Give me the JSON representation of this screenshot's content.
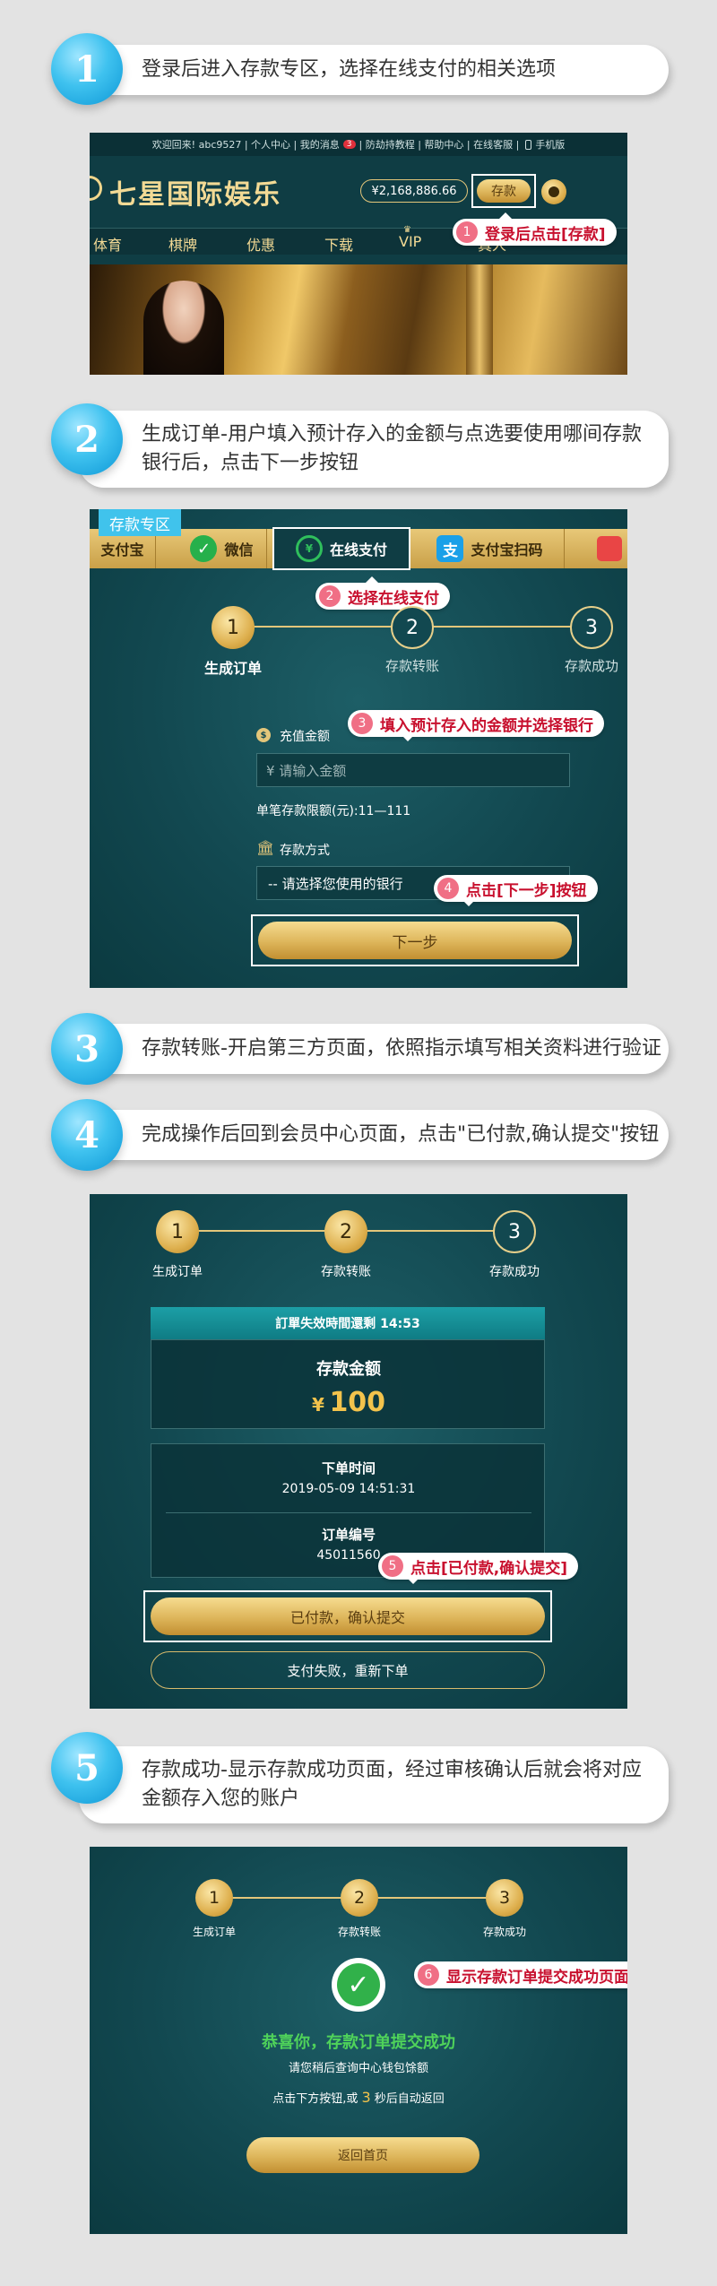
{
  "steps": [
    {
      "number": "1",
      "text": "登录后进入存款专区，选择在线支付的相关选项"
    },
    {
      "number": "2",
      "text": "生成订单-用户填入预计存入的金额与点选要使用哪间存款银行后，点击下一步按钮"
    },
    {
      "number": "3",
      "text": "存款转账-开启第三方页面，依照指示填写相关资料进行验证"
    },
    {
      "number": "4",
      "text": "完成操作后回到会员中心页面，点击\"已付款,确认提交\"按钮"
    },
    {
      "number": "5",
      "text": "存款成功-显示存款成功页面，经过审核确认后就会将对应金额存入您的账户"
    }
  ],
  "panel1": {
    "topbar": "欢迎回来! abc9527 | 个人中心 | 我的消息",
    "msg_badge": "3",
    "topbar_rest": "| 防劫持教程 | 帮助中心 | 在线客服 |",
    "mobile": "手机版",
    "logo": "七星国际娱乐",
    "balance": "¥2,168,886.66",
    "deposit_btn": "存款",
    "nav": [
      "体育",
      "棋牌",
      "优惠",
      "下载",
      "VIP",
      "真人"
    ],
    "callout_num": "1",
    "callout": "登录后点击[存款]"
  },
  "panel2": {
    "tag": "存款专区",
    "tabs": [
      "支付宝",
      "微信",
      "在线支付",
      "支付宝扫码"
    ],
    "callout2_num": "2",
    "callout2": "选择在线支付",
    "progress": [
      {
        "n": "1",
        "label": "生成订单"
      },
      {
        "n": "2",
        "label": "存款转账"
      },
      {
        "n": "3",
        "label": "存款成功"
      }
    ],
    "callout3_num": "3",
    "callout3": "填入预计存入的金额并选择银行",
    "amount_label": "充值金额",
    "amount_placeholder": "¥ 请输入金额",
    "limit": "单笔存款限额(元):11—111",
    "method_label": "存款方式",
    "bank_select": "-- 请选择您使用的银行",
    "callout4_num": "4",
    "callout4": "点击[下一步]按钮",
    "next_btn": "下一步"
  },
  "panel3": {
    "progress": [
      {
        "n": "1",
        "label": "生成订单"
      },
      {
        "n": "2",
        "label": "存款转账"
      },
      {
        "n": "3",
        "label": "存款成功"
      }
    ],
    "expire": "訂單失效時間還剩 14:53",
    "amount_title": "存款金额",
    "currency": "¥",
    "amount": "100",
    "order_time_label": "下单时间",
    "order_time": "2019-05-09 14:51:31",
    "order_no_label": "订单编号",
    "order_no": "45011560",
    "callout5_num": "5",
    "callout5": "点击[已付款,确认提交]",
    "confirm_btn": "已付款，确认提交",
    "fail_btn": "支付失败，重新下单"
  },
  "panel4": {
    "progress": [
      {
        "n": "1",
        "label": "生成订单"
      },
      {
        "n": "2",
        "label": "存款转账"
      },
      {
        "n": "3",
        "label": "存款成功"
      }
    ],
    "callout6_num": "6",
    "callout6": "显示存款订单提交成功页面",
    "success_title": "恭喜你，存款订单提交成功",
    "success_sub": "请您稍后查询中心钱包馀额",
    "countdown_pre": "点击下方按钮,或",
    "countdown_num": "3",
    "countdown_post": "秒后自动返回",
    "home_btn": "返回首页"
  },
  "colors": {
    "accent_blue": "#1aa6e0",
    "callout_red": "#c8102e",
    "panel_teal": "#124850",
    "gold": "#ddb55a"
  }
}
